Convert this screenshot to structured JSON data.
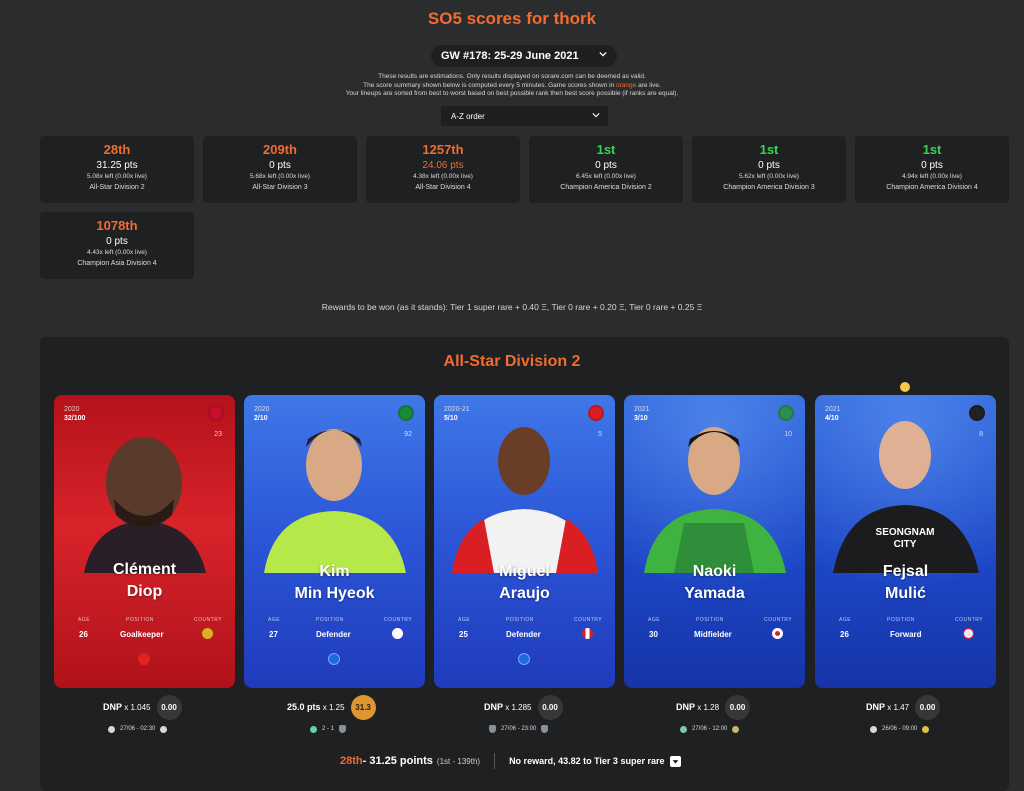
{
  "page": {
    "title": "SO5 scores for thork"
  },
  "gameweek_select": {
    "value": "GW #178: 25-29 June 2021"
  },
  "notes": {
    "line1": "These results are estimations. Only results displayed on sorare.com can be deemed as valid.",
    "line2_pre": "The score summary shown below is computed every 5 minutes. Game scores shown in ",
    "line2_orange": "orange",
    "line2_post": " are live.",
    "line3": "Your lineups are sorted from best to worst based on best possible rank then best score possible (if ranks are equal)."
  },
  "sort_select": {
    "value": "A-Z order"
  },
  "divisions": [
    {
      "rank": "28th",
      "points": "31.25 pts",
      "left": "5.08x left (0.00x live)",
      "name": "All-Star Division 2",
      "rank_color": "#f26b2f",
      "points_color": "#ffffff"
    },
    {
      "rank": "209th",
      "points": "0 pts",
      "left": "5.68x left (0.00x live)",
      "name": "All-Star Division 3",
      "rank_color": "#f26b2f",
      "points_color": "#ffffff"
    },
    {
      "rank": "1257th",
      "points": "24.06 pts",
      "left": "4.38x left (0.00x live)",
      "name": "All-Star Division 4",
      "rank_color": "#f26b2f",
      "points_color": "#f26b2f"
    },
    {
      "rank": "1st",
      "points": "0 pts",
      "left": "6.45x left (0.00x live)",
      "name": "Champion America Division 2",
      "rank_color": "#39d353",
      "points_color": "#ffffff"
    },
    {
      "rank": "1st",
      "points": "0 pts",
      "left": "5.62x left (0.00x live)",
      "name": "Champion America Division 3",
      "rank_color": "#39d353",
      "points_color": "#ffffff"
    },
    {
      "rank": "1st",
      "points": "0 pts",
      "left": "4.94x left (0.00x live)",
      "name": "Champion America Division 4",
      "rank_color": "#39d353",
      "points_color": "#ffffff"
    },
    {
      "rank": "1078th",
      "points": "0 pts",
      "left": "4.43x left (0.00x live)",
      "name": "Champion Asia Division 4",
      "rank_color": "#f26b2f",
      "points_color": "#ffffff"
    }
  ],
  "rewards_text": "Rewards to be won (as it stands): Tier 1 super rare + 0.40 Ξ, Tier 0 rare + 0.20 Ξ, Tier 0 rare + 0.25 Ξ",
  "division_detail": {
    "title": "All-Star Division 2",
    "labels": {
      "age": "AGE",
      "position": "POSITION",
      "country": "COUNTRY"
    },
    "cards": [
      {
        "year": "2020",
        "serial": "32/100",
        "shirt": "23",
        "first": "Clément",
        "last": "Diop",
        "age": "26",
        "position": "Goalkeeper",
        "score_main": "DNP",
        "multiplier": "x 1.045",
        "final": "0.00",
        "gold": false,
        "match_date": "27/06 - 02:30",
        "match_score": "",
        "theme": "red",
        "flag_color": "#d4b222",
        "ball_color": "#e52020",
        "badge_color": "#c8102e"
      },
      {
        "year": "2020",
        "serial": "2/10",
        "shirt": "92",
        "first": "Kim",
        "last": "Min Hyeok",
        "age": "27",
        "position": "Defender",
        "score_main": "25.0 pts",
        "multiplier": "x 1.25",
        "final": "31.3",
        "gold": true,
        "match_date": "",
        "match_score": "2 - 1",
        "theme": "blue",
        "flag_color": "#ffffff",
        "ball_color": "#1e6be0",
        "badge_color": "#1a8a3a"
      },
      {
        "year": "2020-21",
        "serial": "5/10",
        "shirt": "5",
        "first": "Miguel",
        "last": "Araujo",
        "age": "25",
        "position": "Defender",
        "score_main": "DNP",
        "multiplier": "x 1.285",
        "final": "0.00",
        "gold": false,
        "match_date": "27/06 - 23:00",
        "match_score": "",
        "theme": "blue",
        "flag_color": "#d91e24",
        "ball_color": "#1e6be0",
        "badge_color": "#d91e24"
      },
      {
        "year": "2021",
        "serial": "3/10",
        "shirt": "10",
        "first": "Naoki",
        "last": "Yamada",
        "age": "30",
        "position": "Midfielder",
        "score_main": "DNP",
        "multiplier": "x 1.28",
        "final": "0.00",
        "gold": false,
        "match_date": "27/06 - 12:00",
        "match_score": "",
        "theme": "hex",
        "flag_color": "#ffffff",
        "ball_color": "",
        "badge_color": "#2a8f4f"
      },
      {
        "year": "2021",
        "serial": "4/10",
        "shirt": "8",
        "first": "Fejsal",
        "last": "Mulić",
        "age": "26",
        "position": "Forward",
        "score_main": "DNP",
        "multiplier": "x 1.47",
        "final": "0.00",
        "gold": false,
        "match_date": "26/06 - 09:00",
        "match_score": "",
        "theme": "hex",
        "flag_color": "#e8e8ff",
        "ball_color": "",
        "badge_color": "#222222"
      }
    ],
    "summary": {
      "rank": "28th",
      "points": " - 31.25 points",
      "range": "(1st - 139th)",
      "reward": "No reward, 43.82 to Tier 3 super rare"
    }
  }
}
